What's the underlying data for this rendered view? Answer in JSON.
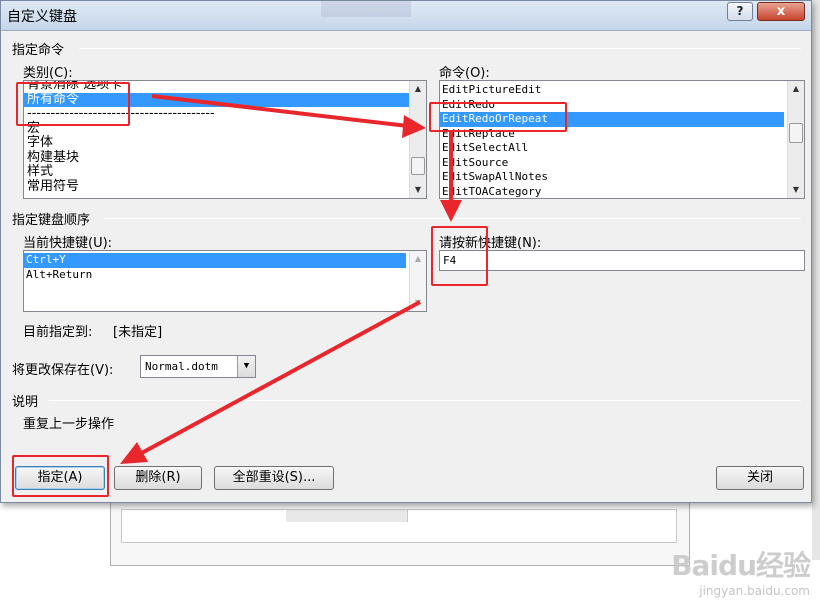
{
  "dialog": {
    "title": "自定义键盘",
    "help_label": "?",
    "close_label": "x"
  },
  "specify_command": {
    "section_label": "指定命令",
    "category_label": "类别(C):",
    "categories": [
      "背景消除 选项卡",
      "所有命令",
      "----------------------------------------",
      "宏",
      "字体",
      "构建基块",
      "样式",
      "常用符号"
    ],
    "command_label": "命令(O):",
    "commands": [
      "EditPictureEdit",
      "EditRedo",
      "EditRedoOrRepeat",
      "EditReplace",
      "EditSelectAll",
      "EditSource",
      "EditSwapAllNotes",
      "EditTOACategory"
    ]
  },
  "keyboard_sequence": {
    "section_label": "指定键盘顺序",
    "current_keys_label": "当前快捷键(U):",
    "current_keys": [
      "Ctrl+Y",
      "Alt+Return"
    ],
    "new_key_label": "请按新快捷键(N):",
    "new_key_value": "F4",
    "assigned_to_label": "目前指定到:",
    "assigned_to_value": "[未指定]"
  },
  "save_in": {
    "label": "将更改保存在(V):",
    "value": "Normal.dotm"
  },
  "description": {
    "section_label": "说明",
    "text": "重复上一步操作"
  },
  "buttons": {
    "assign": "指定(A)",
    "remove": "删除(R)",
    "reset_all": "全部重设(S)...",
    "close": "关闭"
  },
  "watermark": {
    "logo": "Baidu经验",
    "url": "jingyan.baidu.com"
  },
  "colors": {
    "selection": "#3399ff",
    "annotation_red": "#e8262b"
  }
}
